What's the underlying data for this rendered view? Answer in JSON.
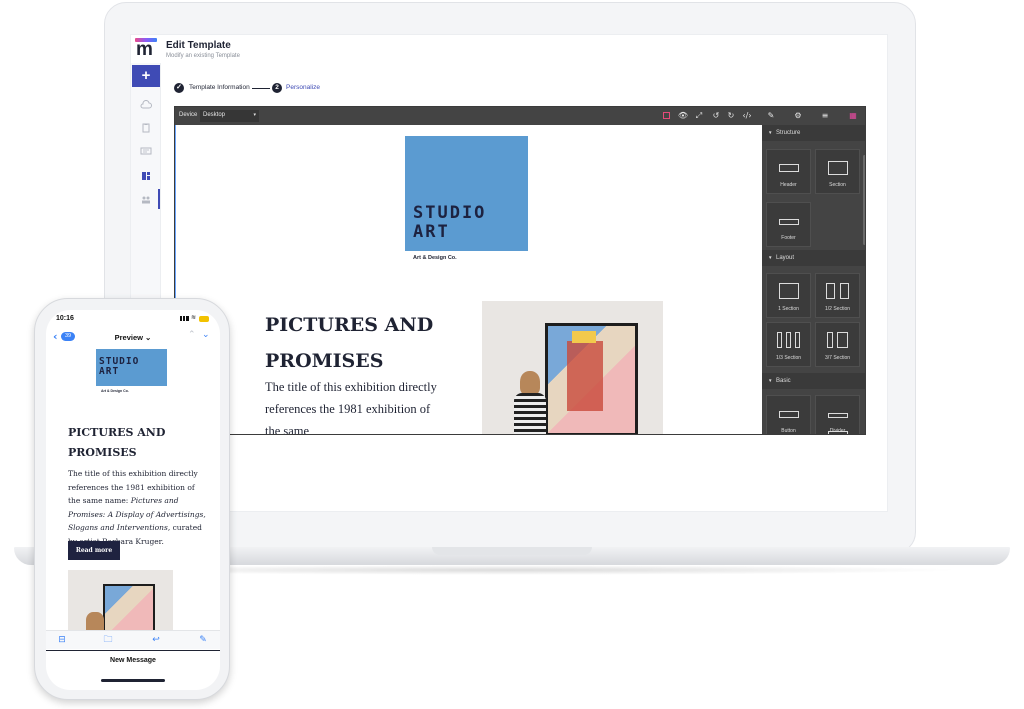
{
  "laptop": {
    "header": {
      "logo_letter": "m",
      "title": "Edit Template",
      "subtitle": "Modify an existing Template"
    },
    "sidebar": {
      "add_label": "+"
    },
    "stepper": {
      "step1": {
        "label": "Template Information",
        "state": "done"
      },
      "step2": {
        "number": "2",
        "label": "Personalize",
        "state": "active"
      }
    },
    "editor": {
      "device_label": "Device",
      "device_value": "Desktop",
      "canvas": {
        "logo_text": "STUDIO\nART",
        "logo_caption": "Art & Design Co.",
        "title": "PICTURES AND PROMISES",
        "body": "The title of this exhibition directly references the 1981 exhibition of the same"
      },
      "panel": {
        "sections": [
          {
            "title": "Structure",
            "blocks": [
              "Header",
              "Section",
              "Footer"
            ]
          },
          {
            "title": "Layout",
            "blocks": [
              "1 Section",
              "1/2 Section",
              "1/3 Section",
              "3/7 Section"
            ]
          },
          {
            "title": "Basic",
            "blocks": [
              "Button",
              "Divider"
            ]
          }
        ]
      }
    }
  },
  "phone": {
    "status": {
      "time": "10:16"
    },
    "nav": {
      "count": "39",
      "title": "Preview ⌄"
    },
    "email": {
      "logo_text": "STUDIO\nART",
      "logo_caption": "Art & Design Co.",
      "title": "PICTURES AND PROMISES",
      "body_start": "The title of this exhibition directly references the 1981 exhibition of the same name: ",
      "body_italic": "Pictures and Promises: A Display of Advertisings, Slogans and Interventions",
      "body_end": ", curated by artist Barbara Kruger.",
      "button": "Read more"
    },
    "footer": {
      "compose_title": "New Message"
    }
  },
  "colors": {
    "accent": "#3f4bb5",
    "logo_blue": "#5b9bd1",
    "editor_dark": "#444444",
    "ios_blue": "#3b82f6"
  }
}
